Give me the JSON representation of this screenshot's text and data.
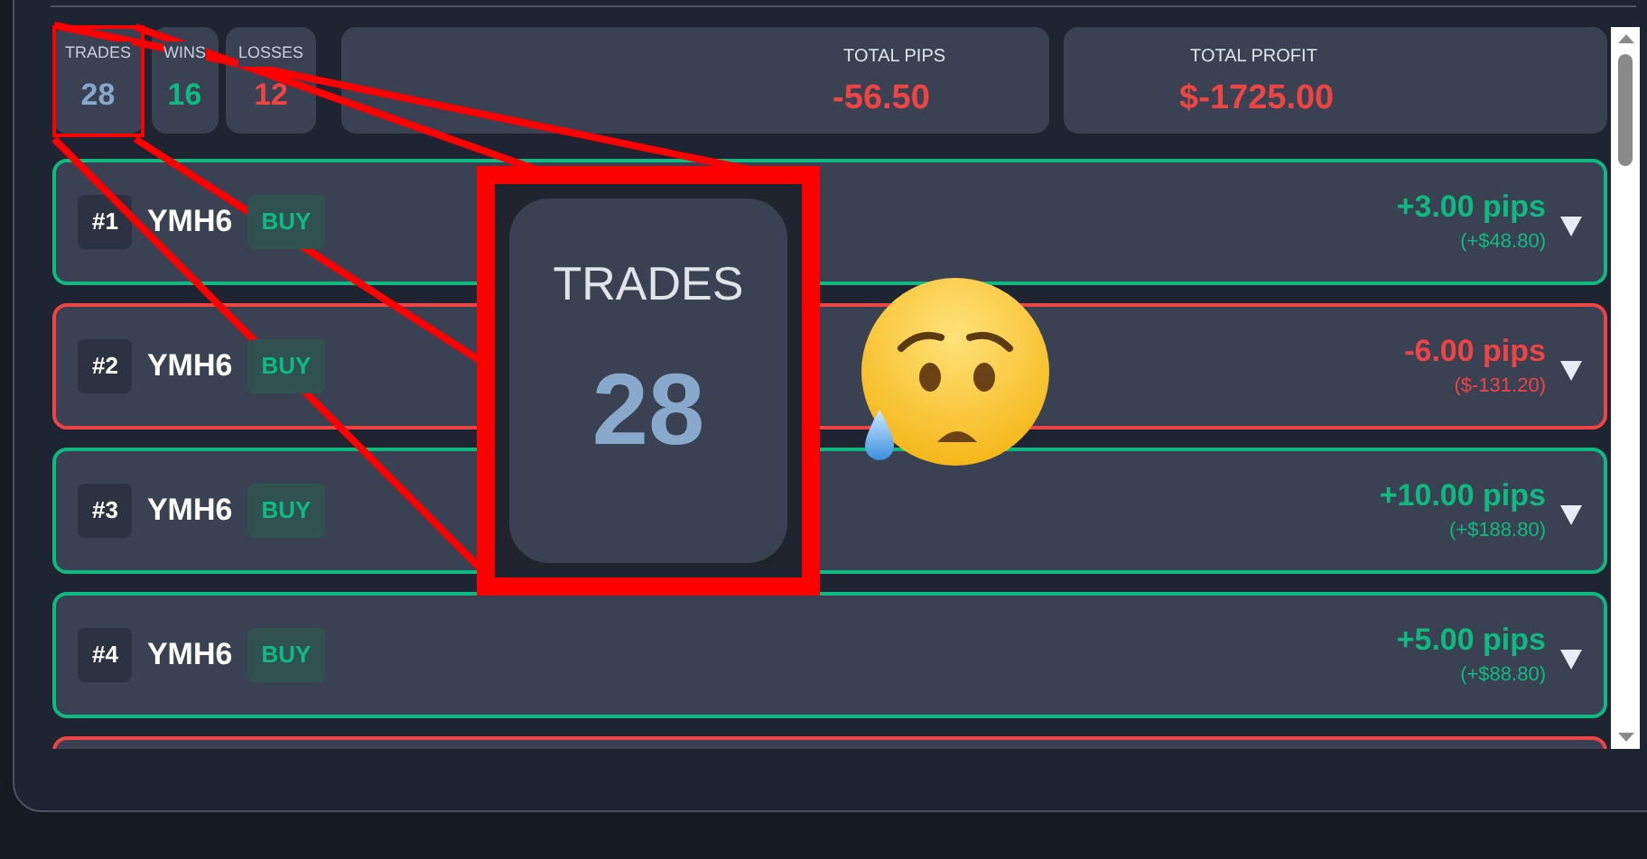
{
  "stats": [
    {
      "label": "TRADES",
      "value": "28",
      "color": "#89a9cc"
    },
    {
      "label": "WINS",
      "value": "16",
      "color": "#10b981"
    },
    {
      "label": "LOSSES",
      "value": "12",
      "color": "#ef4444"
    }
  ],
  "totals": [
    {
      "label": "TOTAL PIPS",
      "value": "-56.50",
      "color": "#ef4444"
    },
    {
      "label": "TOTAL PROFIT",
      "value": "$-1725.00",
      "color": "#ef4444"
    }
  ],
  "trades": [
    {
      "kind": "win",
      "number": "#1",
      "symbol": "YMH6",
      "side": "BUY",
      "pips": "+3.00 pips",
      "profit": "(+$48.80)"
    },
    {
      "kind": "loss",
      "number": "#2",
      "symbol": "YMH6",
      "side": "BUY",
      "pips": "-6.00 pips",
      "profit": "($-131.20)"
    },
    {
      "kind": "win",
      "number": "#3",
      "symbol": "YMH6",
      "side": "BUY",
      "pips": "+10.00 pips",
      "profit": "(+$188.80)"
    },
    {
      "kind": "win",
      "number": "#4",
      "symbol": "YMH6",
      "side": "BUY",
      "pips": "+5.00 pips",
      "profit": "(+$88.80)"
    },
    {
      "kind": "loss"
    }
  ],
  "magnifier": {
    "label": "TRADES",
    "value": "28"
  }
}
